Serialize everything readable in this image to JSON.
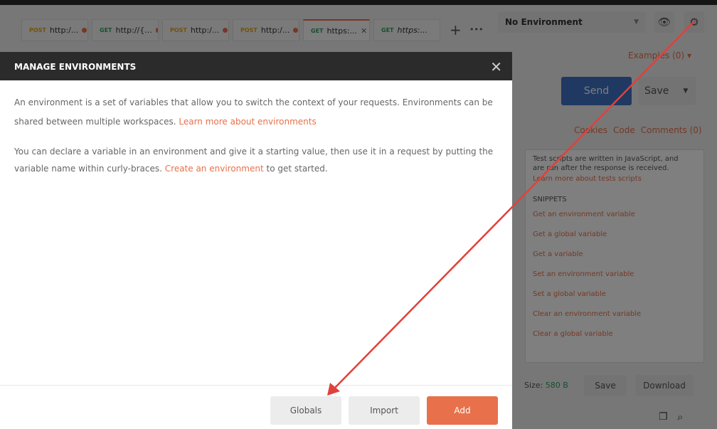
{
  "tabs": [
    {
      "method": "POST",
      "url": "http:/...",
      "unsaved": true
    },
    {
      "method": "GET",
      "url": "http://{...",
      "unsaved": true
    },
    {
      "method": "POST",
      "url": "http:/...",
      "unsaved": true
    },
    {
      "method": "POST",
      "url": "http:/...",
      "unsaved": true
    },
    {
      "method": "GET",
      "url": "https:...",
      "active": true,
      "close": "✕"
    },
    {
      "method": "GET",
      "url": "https:..."
    }
  ],
  "tab_actions": {
    "add": "+",
    "more": "•••"
  },
  "environment": {
    "selected": "No Environment"
  },
  "request": {
    "examples": "Examples (0)",
    "send": "Send",
    "save": "Save",
    "cookies": "Cookies",
    "code": "Code",
    "comments": "Comments (0)"
  },
  "tests_panel": {
    "description": "Test scripts are written in JavaScript, and are run after the response is received.",
    "learn_more": "Learn more about tests scripts",
    "snippets_title": "SNIPPETS",
    "snippets": [
      "Get an environment variable",
      "Get a global variable",
      "Get a variable",
      "Set an environment variable",
      "Set a global variable",
      "Clear an environment variable",
      "Clear a global variable"
    ]
  },
  "response": {
    "size_label": "Size:",
    "size_value": "580 B",
    "save": "Save",
    "download": "Download"
  },
  "modal": {
    "title": "MANAGE ENVIRONMENTS",
    "p1": "An environment is a set of variables that allow you to switch the context of your requests. Environments can be shared between multiple workspaces.",
    "p1_link": "Learn more about environments",
    "p2": "You can declare a variable in an environment and give it a starting value, then use it in a request by putting the variable name within curly-braces.",
    "p2_link": "Create an environment",
    "p2_tail": "to get started.",
    "buttons": {
      "globals": "Globals",
      "import": "Import",
      "add": "Add"
    }
  },
  "colors": {
    "accent": "#e8704a",
    "send": "#3f73c4",
    "annotation_arrow": "#e0413a"
  }
}
